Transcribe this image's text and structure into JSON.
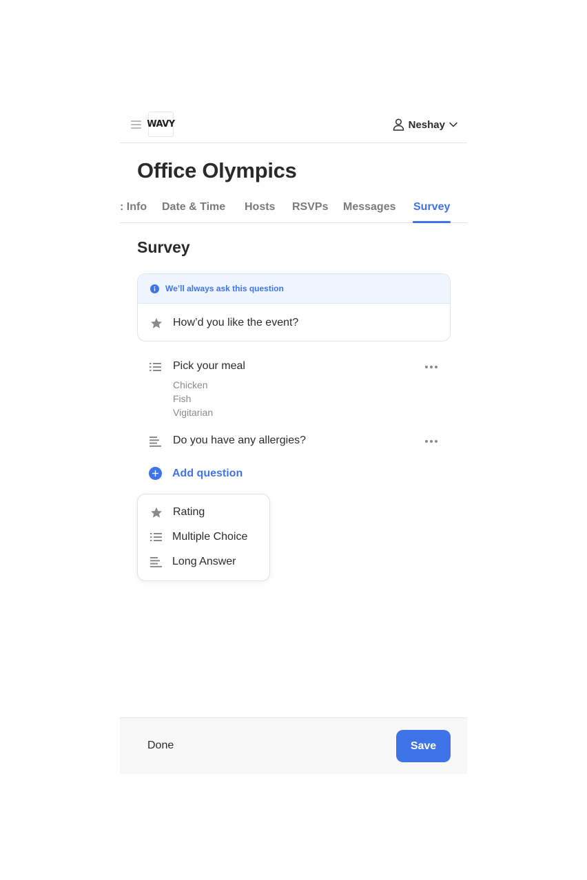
{
  "header": {
    "logo_text": "WAVY",
    "user_name": "Neshay"
  },
  "event": {
    "title": "Office Olympics"
  },
  "tabs": [
    {
      "label": ": Info"
    },
    {
      "label": "Date & Time"
    },
    {
      "label": "Hosts"
    },
    {
      "label": "RSVPs"
    },
    {
      "label": "Messages"
    },
    {
      "label": "Survey",
      "active": true
    }
  ],
  "survey": {
    "title": "Survey",
    "default_banner": "We’ll always ask this question",
    "default_question": "How’d you like the event?",
    "questions": [
      {
        "type": "multiple-choice",
        "text": "Pick your meal",
        "options": [
          "Chicken",
          "Fish",
          "Vigitarian"
        ]
      },
      {
        "type": "long-answer",
        "text": "Do you have any allergies?"
      }
    ],
    "add_label": "Add question",
    "menu": [
      {
        "icon": "star-icon",
        "label": "Rating"
      },
      {
        "icon": "list-icon",
        "label": "Multiple Choice"
      },
      {
        "icon": "lines-icon",
        "label": "Long Answer"
      }
    ]
  },
  "footer": {
    "done_label": "Done",
    "save_label": "Save"
  },
  "colors": {
    "accent": "#3f73e8",
    "banner_bg": "#eef5ff",
    "text": "#2b2b2b",
    "muted": "#8a8a8a"
  }
}
